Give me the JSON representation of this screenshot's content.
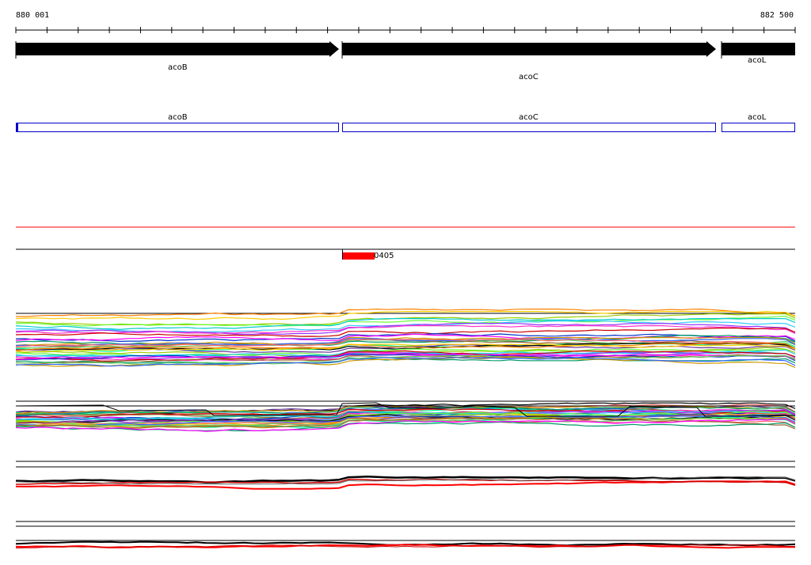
{
  "ruler": {
    "start_label": "880 001",
    "end_label": "882 500"
  },
  "genes": [
    {
      "name": "acoB",
      "strand": "+"
    },
    {
      "name": "acoC",
      "strand": "+"
    },
    {
      "name": "acoL",
      "strand": "+"
    }
  ],
  "cds": [
    {
      "name": "acoB"
    },
    {
      "name": "acoC"
    },
    {
      "name": "acoL"
    }
  ],
  "feature": {
    "label": "0405"
  },
  "colors": {
    "gene_arrow": "#000000",
    "cds_box": "#0000cc",
    "feature": "#ff0000",
    "separator_red": "#ff0000"
  }
}
